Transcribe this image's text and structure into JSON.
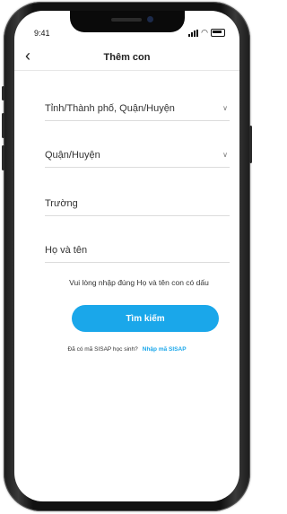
{
  "status_bar": {
    "time": "9:41"
  },
  "header": {
    "back_icon": "chevron-left-icon",
    "title": "Thêm con"
  },
  "form": {
    "fields": [
      {
        "label": "Tỉnh/Thành phố, Quận/Huyện",
        "has_dropdown": true
      },
      {
        "label": "Quận/Huyện",
        "has_dropdown": true
      },
      {
        "label": "Trường",
        "has_dropdown": false
      },
      {
        "label": "Họ và tên",
        "has_dropdown": false
      }
    ],
    "hint": "Vui lòng nhập đúng Họ và tên con có dấu",
    "search_button": "Tìm kiếm"
  },
  "footer": {
    "question": "Đã có mã SISAP học sinh?",
    "link": "Nhập mã SISAP"
  },
  "colors": {
    "accent": "#1aa7ea",
    "frame": "#111111"
  }
}
